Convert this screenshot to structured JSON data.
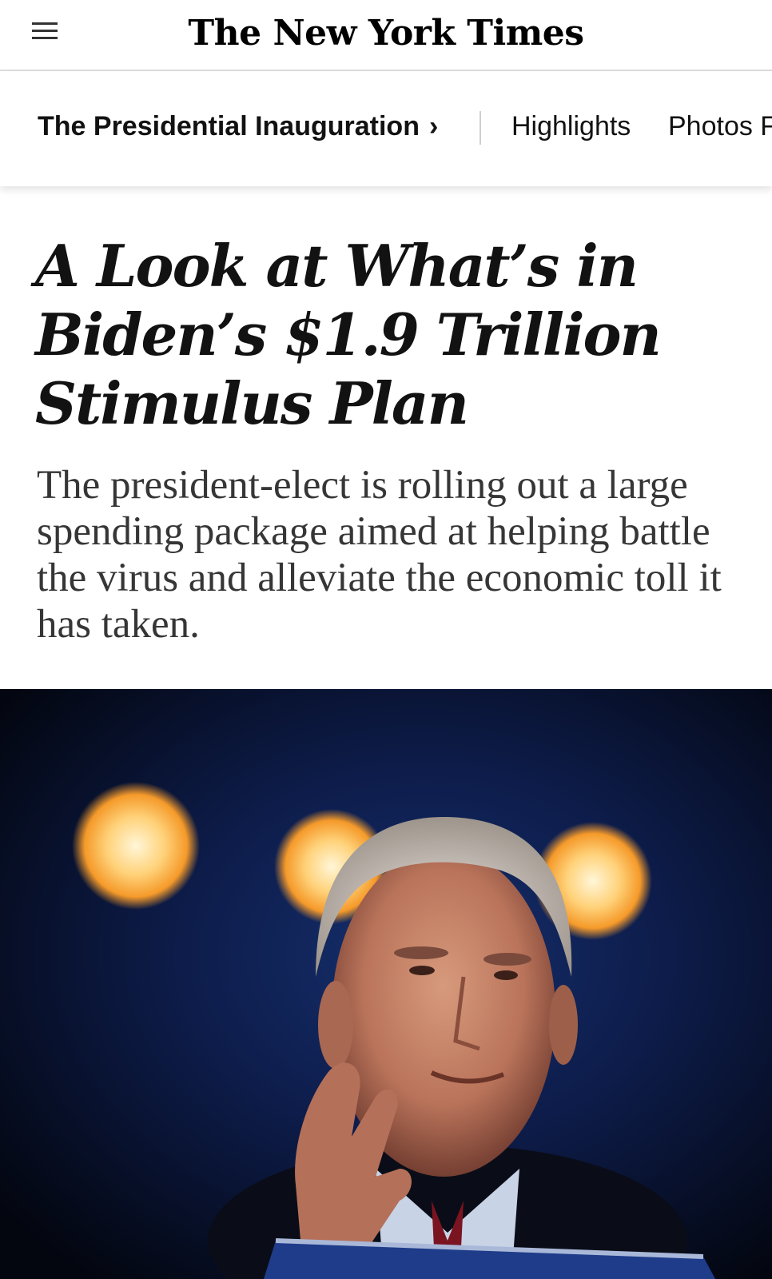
{
  "header": {
    "menu_icon": "hamburger-menu-icon",
    "logo_text": "The New York Times"
  },
  "section_nav": {
    "title": "The Presidential Inauguration",
    "chevron": "›",
    "links": [
      {
        "label": "Highlights"
      },
      {
        "label": "Photos F"
      }
    ]
  },
  "article": {
    "headline": "A Look at What’s in Biden’s $1.9 Trillion Stimulus Plan",
    "summary": "The president-elect is rolling out a large spending package aimed at helping battle the virus and alleviate the economic toll it has taken."
  },
  "colors": {
    "text": "#121212",
    "summary_text": "#363636",
    "divider": "#cfcfcf",
    "photo_background": "#050a1c",
    "light_glow": "#ffb347"
  }
}
